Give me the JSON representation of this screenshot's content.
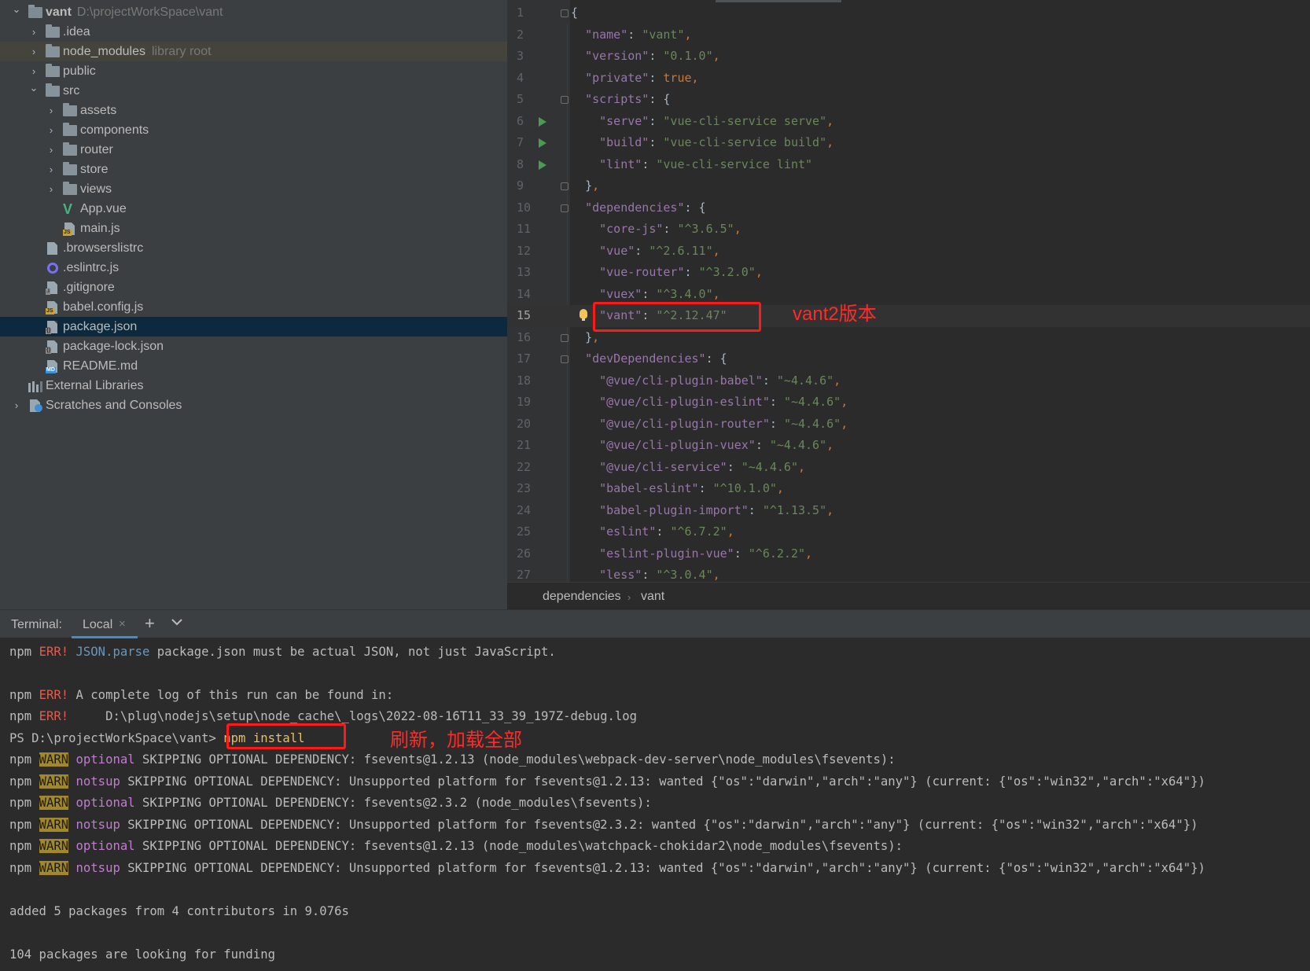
{
  "project_tree": {
    "items": [
      {
        "label": "vant",
        "hint": "D:\\projectWorkSpace\\vant",
        "icon": "project-folder-icon",
        "depth": 0,
        "expanded": true
      },
      {
        "label": ".idea",
        "icon": "folder-icon",
        "depth": 1,
        "expanded": false
      },
      {
        "label": "node_modules",
        "hint": "library root",
        "icon": "folder-icon",
        "depth": 1,
        "expanded": false
      },
      {
        "label": "public",
        "icon": "folder-icon",
        "depth": 1,
        "expanded": false
      },
      {
        "label": "src",
        "icon": "folder-icon",
        "depth": 1,
        "expanded": true
      },
      {
        "label": "assets",
        "icon": "folder-icon",
        "depth": 2,
        "expanded": false
      },
      {
        "label": "components",
        "icon": "folder-icon",
        "depth": 2,
        "expanded": false
      },
      {
        "label": "router",
        "icon": "folder-icon",
        "depth": 2,
        "expanded": false
      },
      {
        "label": "store",
        "icon": "folder-icon",
        "depth": 2,
        "expanded": false
      },
      {
        "label": "views",
        "icon": "folder-icon",
        "depth": 2,
        "expanded": false
      },
      {
        "label": "App.vue",
        "icon": "vue-file-icon",
        "depth": 2
      },
      {
        "label": "main.js",
        "icon": "js-file-icon",
        "depth": 2
      },
      {
        "label": ".browserslistrc",
        "icon": "text-file-icon",
        "depth": 1
      },
      {
        "label": ".eslintrc.js",
        "icon": "eslint-file-icon",
        "depth": 1
      },
      {
        "label": ".gitignore",
        "icon": "ignore-file-icon",
        "depth": 1
      },
      {
        "label": "babel.config.js",
        "icon": "js-file-icon",
        "depth": 1
      },
      {
        "label": "package.json",
        "icon": "json-file-icon",
        "depth": 1,
        "selected": true
      },
      {
        "label": "package-lock.json",
        "icon": "json-file-icon",
        "depth": 1
      },
      {
        "label": "README.md",
        "icon": "markdown-file-icon",
        "depth": 1
      },
      {
        "label": "External Libraries",
        "icon": "libraries-icon",
        "depth": 0
      },
      {
        "label": "Scratches and Consoles",
        "icon": "scratches-icon",
        "depth": 0,
        "expanded": false
      }
    ]
  },
  "editor": {
    "current_line": 15,
    "lines": [
      {
        "n": "1",
        "code": "{"
      },
      {
        "n": "2",
        "code": "  \"name\": \"vant\","
      },
      {
        "n": "3",
        "code": "  \"version\": \"0.1.0\","
      },
      {
        "n": "4",
        "code": "  \"private\": true,"
      },
      {
        "n": "5",
        "code": "  \"scripts\": {"
      },
      {
        "n": "6",
        "code": "    \"serve\": \"vue-cli-service serve\",",
        "run": true
      },
      {
        "n": "7",
        "code": "    \"build\": \"vue-cli-service build\",",
        "run": true
      },
      {
        "n": "8",
        "code": "    \"lint\": \"vue-cli-service lint\"",
        "run": true
      },
      {
        "n": "9",
        "code": "  },"
      },
      {
        "n": "10",
        "code": "  \"dependencies\": {"
      },
      {
        "n": "11",
        "code": "    \"core-js\": \"^3.6.5\","
      },
      {
        "n": "12",
        "code": "    \"vue\": \"^2.6.11\","
      },
      {
        "n": "13",
        "code": "    \"vue-router\": \"^3.2.0\","
      },
      {
        "n": "14",
        "code": "    \"vuex\": \"^3.4.0\","
      },
      {
        "n": "15",
        "code": "    \"vant\": \"^2.12.47\""
      },
      {
        "n": "16",
        "code": "  },"
      },
      {
        "n": "17",
        "code": "  \"devDependencies\": {"
      },
      {
        "n": "18",
        "code": "    \"@vue/cli-plugin-babel\": \"~4.4.6\","
      },
      {
        "n": "19",
        "code": "    \"@vue/cli-plugin-eslint\": \"~4.4.6\","
      },
      {
        "n": "20",
        "code": "    \"@vue/cli-plugin-router\": \"~4.4.6\","
      },
      {
        "n": "21",
        "code": "    \"@vue/cli-plugin-vuex\": \"~4.4.6\","
      },
      {
        "n": "22",
        "code": "    \"@vue/cli-service\": \"~4.4.6\","
      },
      {
        "n": "23",
        "code": "    \"babel-eslint\": \"^10.1.0\","
      },
      {
        "n": "24",
        "code": "    \"babel-plugin-import\": \"^1.13.5\","
      },
      {
        "n": "25",
        "code": "    \"eslint\": \"^6.7.2\","
      },
      {
        "n": "26",
        "code": "    \"eslint-plugin-vue\": \"^6.2.2\","
      },
      {
        "n": "27",
        "code": "    \"less\": \"^3.0.4\","
      }
    ],
    "annotation": "vant2版本",
    "breadcrumb": [
      "dependencies",
      "vant"
    ]
  },
  "terminal": {
    "title": "Terminal:",
    "tab_label": "Local",
    "annotation": "刷新，加载全部",
    "lines": [
      "npm ERR! JSON.parse package.json must be actual JSON, not just JavaScript.",
      "",
      "npm ERR! A complete log of this run can be found in:",
      "npm ERR!     D:\\plug\\nodejs\\setup\\node_cache\\_logs\\2022-08-16T11_33_39_197Z-debug.log",
      "PS D:\\projectWorkSpace\\vant> npm install",
      "npm WARN optional SKIPPING OPTIONAL DEPENDENCY: fsevents@1.2.13 (node_modules\\webpack-dev-server\\node_modules\\fsevents):",
      "npm WARN notsup SKIPPING OPTIONAL DEPENDENCY: Unsupported platform for fsevents@1.2.13: wanted {\"os\":\"darwin\",\"arch\":\"any\"} (current: {\"os\":\"win32\",\"arch\":\"x64\"})",
      "npm WARN optional SKIPPING OPTIONAL DEPENDENCY: fsevents@2.3.2 (node_modules\\fsevents):",
      "npm WARN notsup SKIPPING OPTIONAL DEPENDENCY: Unsupported platform for fsevents@2.3.2: wanted {\"os\":\"darwin\",\"arch\":\"any\"} (current: {\"os\":\"win32\",\"arch\":\"x64\"})",
      "npm WARN optional SKIPPING OPTIONAL DEPENDENCY: fsevents@1.2.13 (node_modules\\watchpack-chokidar2\\node_modules\\fsevents):",
      "npm WARN notsup SKIPPING OPTIONAL DEPENDENCY: Unsupported platform for fsevents@1.2.13: wanted {\"os\":\"darwin\",\"arch\":\"any\"} (current: {\"os\":\"win32\",\"arch\":\"x64\"})",
      "",
      "added 5 packages from 4 contributors in 9.076s",
      "",
      "104 packages are looking for funding"
    ]
  },
  "colors": {
    "annotation_red": "#ff1a1a",
    "selection_blue": "#0d293e",
    "json_key": "#9876aa",
    "json_string": "#6a8759",
    "json_keyword": "#cc7832"
  }
}
